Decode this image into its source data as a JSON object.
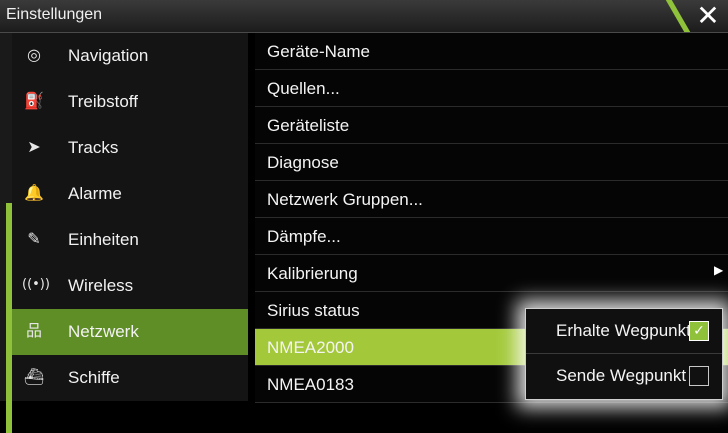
{
  "window": {
    "title": "Einstellungen",
    "close_glyph": "✕"
  },
  "sidebar": {
    "items": [
      {
        "label": "Navigation",
        "icon": "compass-icon",
        "glyph": "◎"
      },
      {
        "label": "Treibstoff",
        "icon": "fuel-icon",
        "glyph": "⛽"
      },
      {
        "label": "Tracks",
        "icon": "tracks-icon",
        "glyph": "➤"
      },
      {
        "label": "Alarme",
        "icon": "bell-icon",
        "glyph": "🔔"
      },
      {
        "label": "Einheiten",
        "icon": "ruler-icon",
        "glyph": "✎"
      },
      {
        "label": "Wireless",
        "icon": "wireless-icon",
        "glyph": "((•))"
      },
      {
        "label": "Netzwerk",
        "icon": "network-icon",
        "glyph": "品"
      },
      {
        "label": "Schiffe",
        "icon": "vessels-icon",
        "glyph": "⛴"
      }
    ],
    "active": "Netzwerk"
  },
  "main": {
    "rows": [
      {
        "label": "Geräte-Name"
      },
      {
        "label": "Quellen..."
      },
      {
        "label": "Geräteliste"
      },
      {
        "label": "Diagnose"
      },
      {
        "label": "Netzwerk Gruppen..."
      },
      {
        "label": "Dämpfe..."
      },
      {
        "label": "Kalibrierung",
        "chevron": "▶"
      },
      {
        "label": "Sirius status"
      },
      {
        "label": "NMEA2000"
      },
      {
        "label": "NMEA0183"
      }
    ],
    "selected": "NMEA2000"
  },
  "popup": {
    "items": [
      {
        "label": "Erhalte Wegpunkt",
        "checked": true,
        "check_glyph": "✓"
      },
      {
        "label": "Sende Wegpunkt",
        "checked": false
      }
    ]
  },
  "colors": {
    "accent": "#8fc13a",
    "selected_row": "#a3c93a",
    "active_sidebar": "#5f8d26"
  }
}
